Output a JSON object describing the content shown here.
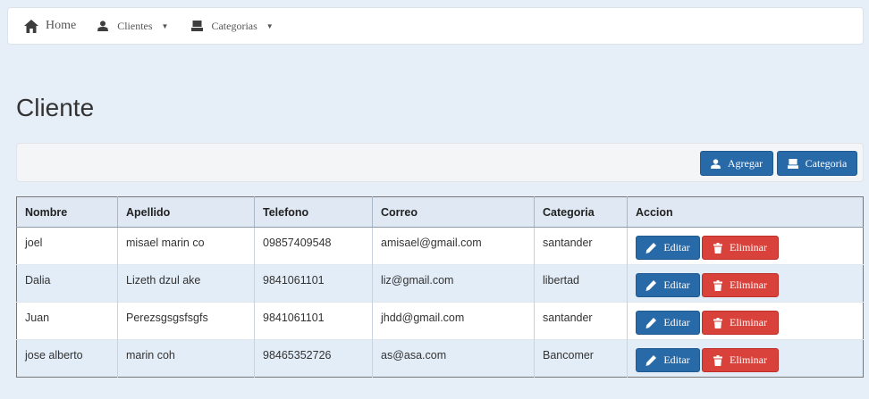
{
  "nav": {
    "home": "Home",
    "clientes": "Clientes",
    "categorias": "Categorias"
  },
  "page": {
    "title": "Cliente"
  },
  "toolbar": {
    "agregar": "Agregar",
    "categoria": "Categoria"
  },
  "table": {
    "headers": [
      "Nombre",
      "Apellido",
      "Telefono",
      "Correo",
      "Categoria",
      "Accion"
    ],
    "rows": [
      [
        "joel",
        "misael marin co",
        "09857409548",
        "amisael@gmail.com",
        "santander"
      ],
      [
        "Dalia",
        "Lizeth dzul ake",
        "9841061101",
        "liz@gmail.com",
        "libertad"
      ],
      [
        "Juan",
        "Perezsgsgsfsgfs",
        "9841061101",
        "jhdd@gmail.com",
        "santander"
      ],
      [
        "jose alberto",
        "marin coh",
        "98465352726",
        "as@asa.com",
        "Bancomer"
      ]
    ],
    "actions": {
      "edit": "Editar",
      "delete": "Eliminar"
    }
  },
  "colors": {
    "primary": "#286aa8",
    "danger": "#d9413b",
    "background": "#e6eef8"
  },
  "icons": [
    "home-icon",
    "user-icon",
    "hdd-icon",
    "caret-down-icon",
    "pencil-icon",
    "trash-icon"
  ]
}
